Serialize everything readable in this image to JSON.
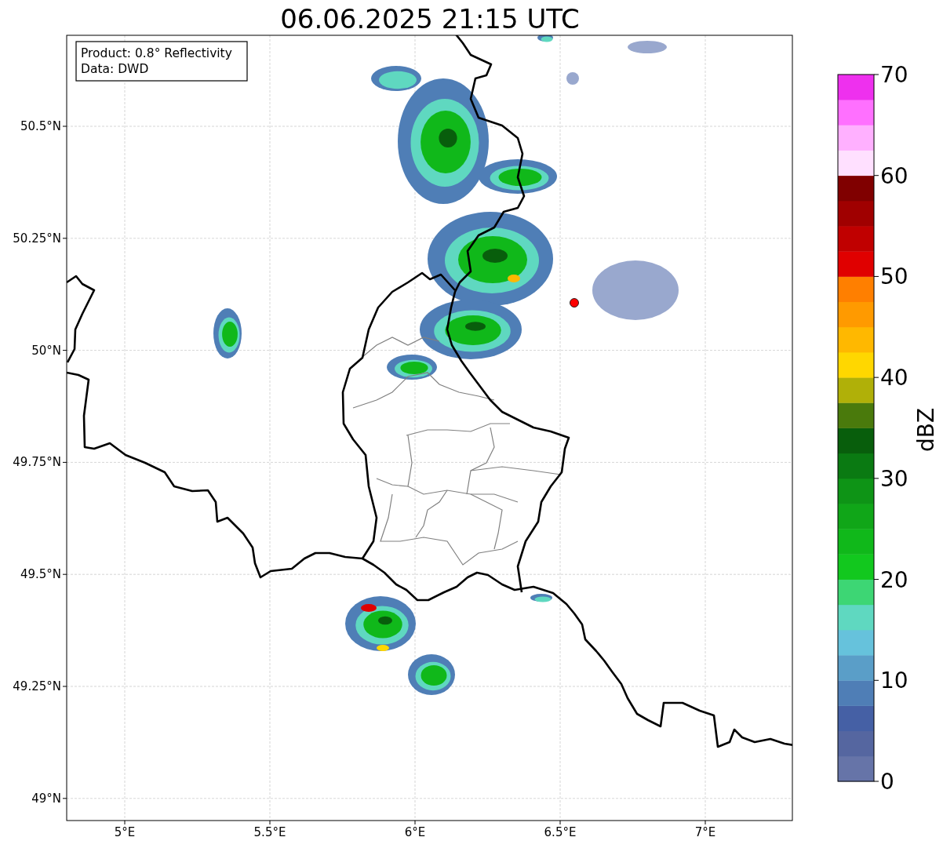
{
  "title": "06.06.2025 21:15 UTC",
  "info_box": [
    "Product: 0.8° Reflectivity",
    "Data: DWD"
  ],
  "map": {
    "x_ticks": [
      "5°E",
      "5.5°E",
      "6°E",
      "6.5°E",
      "7°E"
    ],
    "y_ticks": [
      "50.5°N",
      "50.25°N",
      "50°N",
      "49.75°N",
      "49.5°N",
      "49.25°N",
      "49°N"
    ]
  },
  "colorbar": {
    "label": "dBZ",
    "ticks": [
      "70",
      "60",
      "50",
      "40",
      "30",
      "20",
      "10",
      "0"
    ],
    "bands": [
      {
        "color": "#6674a8"
      },
      {
        "color": "#5566a0"
      },
      {
        "color": "#4560a5"
      },
      {
        "color": "#4f7eb6"
      },
      {
        "color": "#5a9ec8"
      },
      {
        "color": "#66c2dc"
      },
      {
        "color": "#5fd8c0"
      },
      {
        "color": "#3dd674"
      },
      {
        "color": "#12c81e"
      },
      {
        "color": "#10b81a"
      },
      {
        "color": "#10a618"
      },
      {
        "color": "#0e9416"
      },
      {
        "color": "#0a7a12"
      },
      {
        "color": "#085e0c"
      },
      {
        "color": "#4a7a0c"
      },
      {
        "color": "#b0b008"
      },
      {
        "color": "#ffd700"
      },
      {
        "color": "#ffb800"
      },
      {
        "color": "#ff9a00"
      },
      {
        "color": "#ff7f00"
      },
      {
        "color": "#e00000"
      },
      {
        "color": "#c00000"
      },
      {
        "color": "#a00000"
      },
      {
        "color": "#800000"
      },
      {
        "color": "#ffe0ff"
      },
      {
        "color": "#ffb0ff"
      },
      {
        "color": "#ff70ff"
      },
      {
        "color": "#ee30ee"
      }
    ]
  }
}
